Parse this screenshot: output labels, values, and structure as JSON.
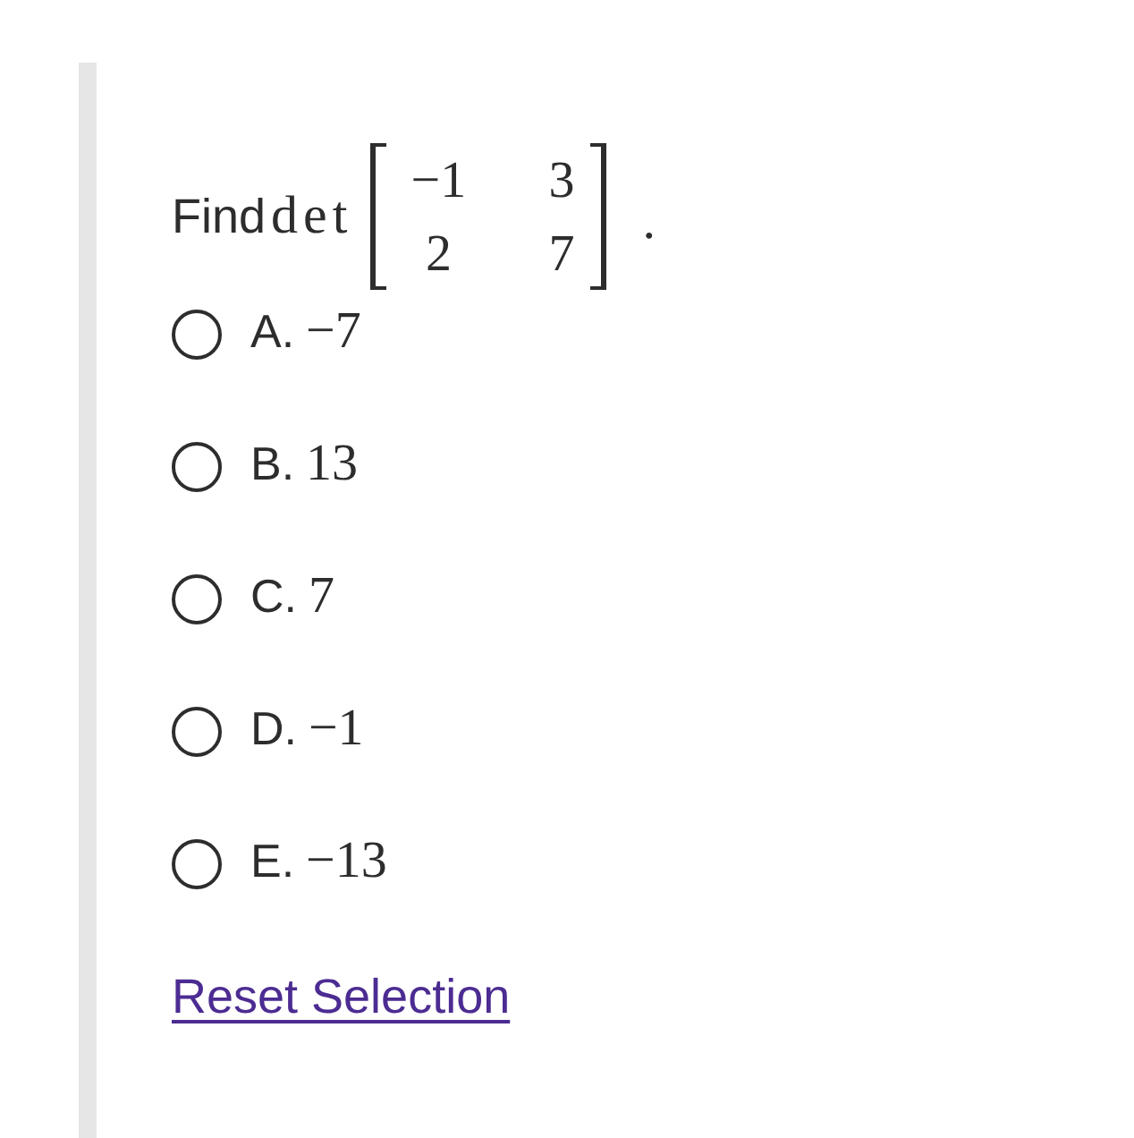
{
  "question": {
    "prompt": "Find",
    "operator": "det",
    "matrix": [
      [
        "−1",
        "3"
      ],
      [
        "2",
        "7"
      ]
    ],
    "end_mark": "."
  },
  "options": [
    {
      "letter": "A.",
      "value": "−7",
      "selected": false
    },
    {
      "letter": "B.",
      "value": "13",
      "selected": false
    },
    {
      "letter": "C.",
      "value": "7",
      "selected": false
    },
    {
      "letter": "D.",
      "value": "−1",
      "selected": false
    },
    {
      "letter": "E.",
      "value": "−13",
      "selected": false
    }
  ],
  "reset_link": "Reset Selection"
}
